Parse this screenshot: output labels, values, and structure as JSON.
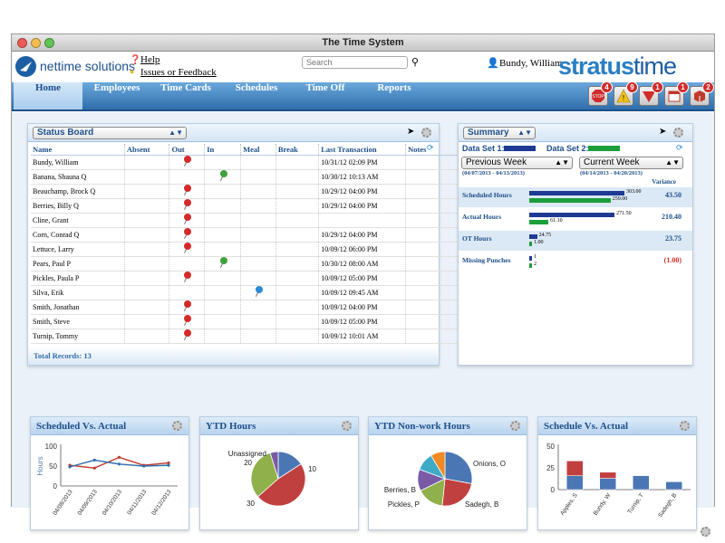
{
  "window": {
    "title": "The Time System"
  },
  "header": {
    "logo_text": "nettime solutions",
    "help_label": "Help",
    "feedback_label": "Issues or Feedback",
    "search_placeholder": "Search",
    "user_name": "Bundy, William",
    "brand_a": "stratus",
    "brand_b": "time"
  },
  "nav": {
    "items": [
      {
        "label": "Home"
      },
      {
        "label": "Employees"
      },
      {
        "label": "Time Cards"
      },
      {
        "label": "Schedules"
      },
      {
        "label": "Time Off"
      },
      {
        "label": "Reports"
      }
    ],
    "alerts": [
      {
        "icon": "stop-sign-icon",
        "count": "4",
        "color": "#d12b2b"
      },
      {
        "icon": "warning-icon",
        "count": "9",
        "color": "#f2c21a"
      },
      {
        "icon": "down-arrow-alert-icon",
        "count": "1",
        "color": "#d12b2b"
      },
      {
        "icon": "calendar-alert-icon",
        "count": "1",
        "color": "#c0392b"
      },
      {
        "icon": "package-alert-icon",
        "count": "2",
        "color": "#c0392b"
      }
    ]
  },
  "status_board": {
    "title": "Status Board",
    "columns": [
      "Name",
      "Absent",
      "Out",
      "In",
      "Meal",
      "Break",
      "Last Transaction",
      "Notes"
    ],
    "rows": [
      {
        "name": "Bundy, William",
        "pin": "red",
        "pin_col": "out",
        "last": "10/31/12 02:09 PM"
      },
      {
        "name": "Banana, Shauna Q",
        "pin": "green",
        "pin_col": "in",
        "last": "10/30/12 10:13 AM"
      },
      {
        "name": "Beauchamp, Brock Q",
        "pin": "red",
        "pin_col": "out",
        "last": "10/29/12 04:00 PM"
      },
      {
        "name": "Berries, Billy Q",
        "pin": "red",
        "pin_col": "out",
        "last": "10/29/12 04:00 PM"
      },
      {
        "name": "Cline, Grant",
        "pin": "red",
        "pin_col": "out",
        "last": ""
      },
      {
        "name": "Corn, Conrad Q",
        "pin": "red",
        "pin_col": "out",
        "last": "10/29/12 04:00 PM"
      },
      {
        "name": "Lettuce, Larry",
        "pin": "red",
        "pin_col": "out",
        "last": "10/09/12 06:00 PM"
      },
      {
        "name": "Pears, Paul P",
        "pin": "green",
        "pin_col": "in",
        "last": "10/30/12 08:00 AM"
      },
      {
        "name": "Pickles, Paula P",
        "pin": "red",
        "pin_col": "out",
        "last": "10/09/12 05:00 PM"
      },
      {
        "name": "Silva, Erik",
        "pin": "blue",
        "pin_col": "meal",
        "last": "10/09/12 09:45 AM"
      },
      {
        "name": "Smith, Jonathan",
        "pin": "red",
        "pin_col": "out",
        "last": "10/09/12 04:00 PM"
      },
      {
        "name": "Smith, Steve",
        "pin": "red",
        "pin_col": "out",
        "last": "10/09/12 05:00 PM"
      },
      {
        "name": "Turnip, Tommy",
        "pin": "red",
        "pin_col": "out",
        "last": "10/09/12 10:01 AM"
      }
    ],
    "footer": "Total Records: 13"
  },
  "summary": {
    "title": "Summary",
    "set1_label": "Data Set 1:",
    "set2_label": "Data Set 2:",
    "set1_color": "#1f3a93",
    "set2_color": "#1c9e3a",
    "set1_select": "Previous Week",
    "set2_select": "Current Week",
    "set1_range": "(04/07/2013 - 04/13/2013)",
    "set2_range": "(04/14/2013 - 04/20/2013)",
    "variance_header": "Variance",
    "rows": [
      {
        "label": "Scheduled Hours",
        "v1": 303,
        "v1_text": "303.00",
        "v2": 259,
        "v2_text": "259.00",
        "variance": "43.50",
        "negative": false
      },
      {
        "label": "Actual Hours",
        "v1": 271.5,
        "v1_text": "271.50",
        "v2": 61.1,
        "v2_text": "61.10",
        "variance": "210.40",
        "negative": false
      },
      {
        "label": "OT Hours",
        "v1": 24.75,
        "v1_text": "24.75",
        "v2": 1,
        "v2_text": "1.00",
        "variance": "23.75",
        "negative": false
      },
      {
        "label": "Missing Punches",
        "v1": 1,
        "v1_text": "1",
        "v2": 2,
        "v2_text": "2",
        "variance": "(1.00)",
        "negative": true
      }
    ],
    "max": 303
  },
  "charts": {
    "scheduled_vs_actual": {
      "title": "Scheduled Vs. Actual"
    },
    "ytd_hours": {
      "title": "YTD Hours"
    },
    "ytd_nonwork": {
      "title": "YTD Non-work Hours"
    },
    "schedule_vs_actual": {
      "title": "Schedule Vs. Actual"
    }
  },
  "chart_data": [
    {
      "type": "line",
      "title": "Scheduled Vs. Actual",
      "ylabel": "Hours",
      "ylim": [
        0,
        100
      ],
      "yticks": [
        0,
        50,
        100
      ],
      "x": [
        "04/08/2013",
        "04/09/2013",
        "04/10/2013",
        "04/11/2013",
        "04/12/2013"
      ],
      "series": [
        {
          "color": "#c0392b",
          "values": [
            52,
            45,
            72,
            52,
            58
          ]
        },
        {
          "color": "#2f6eac",
          "values": [
            48,
            65,
            55,
            50,
            52
          ]
        }
      ]
    },
    {
      "type": "pie",
      "title": "YTD Hours",
      "slices": [
        {
          "label": "10",
          "value": 10,
          "color": "#4a77b4"
        },
        {
          "label": "30",
          "value": 30,
          "color": "#c0403f"
        },
        {
          "label": "20",
          "value": 20,
          "color": "#8fb04a"
        },
        {
          "label": "Unassigned",
          "value": 3,
          "color": "#7a5aa5"
        }
      ]
    },
    {
      "type": "pie",
      "title": "YTD Non-work Hours",
      "slices": [
        {
          "label": "Onions, O",
          "value": 26,
          "color": "#4a77b4"
        },
        {
          "label": "Sadegh, B",
          "value": 22,
          "color": "#c0403f"
        },
        {
          "label": "",
          "value": 15,
          "color": "#8fb04a"
        },
        {
          "label": "Pickles, P",
          "value": 12,
          "color": "#7a5aa5"
        },
        {
          "label": "Berries, B",
          "value": 10,
          "color": "#3eaac6"
        },
        {
          "label": "",
          "value": 8,
          "color": "#f08a24"
        }
      ]
    },
    {
      "type": "bar",
      "title": "Schedule Vs. Actual",
      "ylim": [
        0,
        50
      ],
      "yticks": [
        0,
        25,
        50
      ],
      "categories": [
        "Apples, S",
        "Bundy, W",
        "Turnip, T",
        "Sadegh, B"
      ],
      "series": [
        {
          "color": "#4a77b4",
          "values": [
            16,
            13,
            16,
            9
          ]
        },
        {
          "color": "#c0403f",
          "values": [
            17,
            7,
            0,
            0
          ]
        }
      ]
    }
  ]
}
